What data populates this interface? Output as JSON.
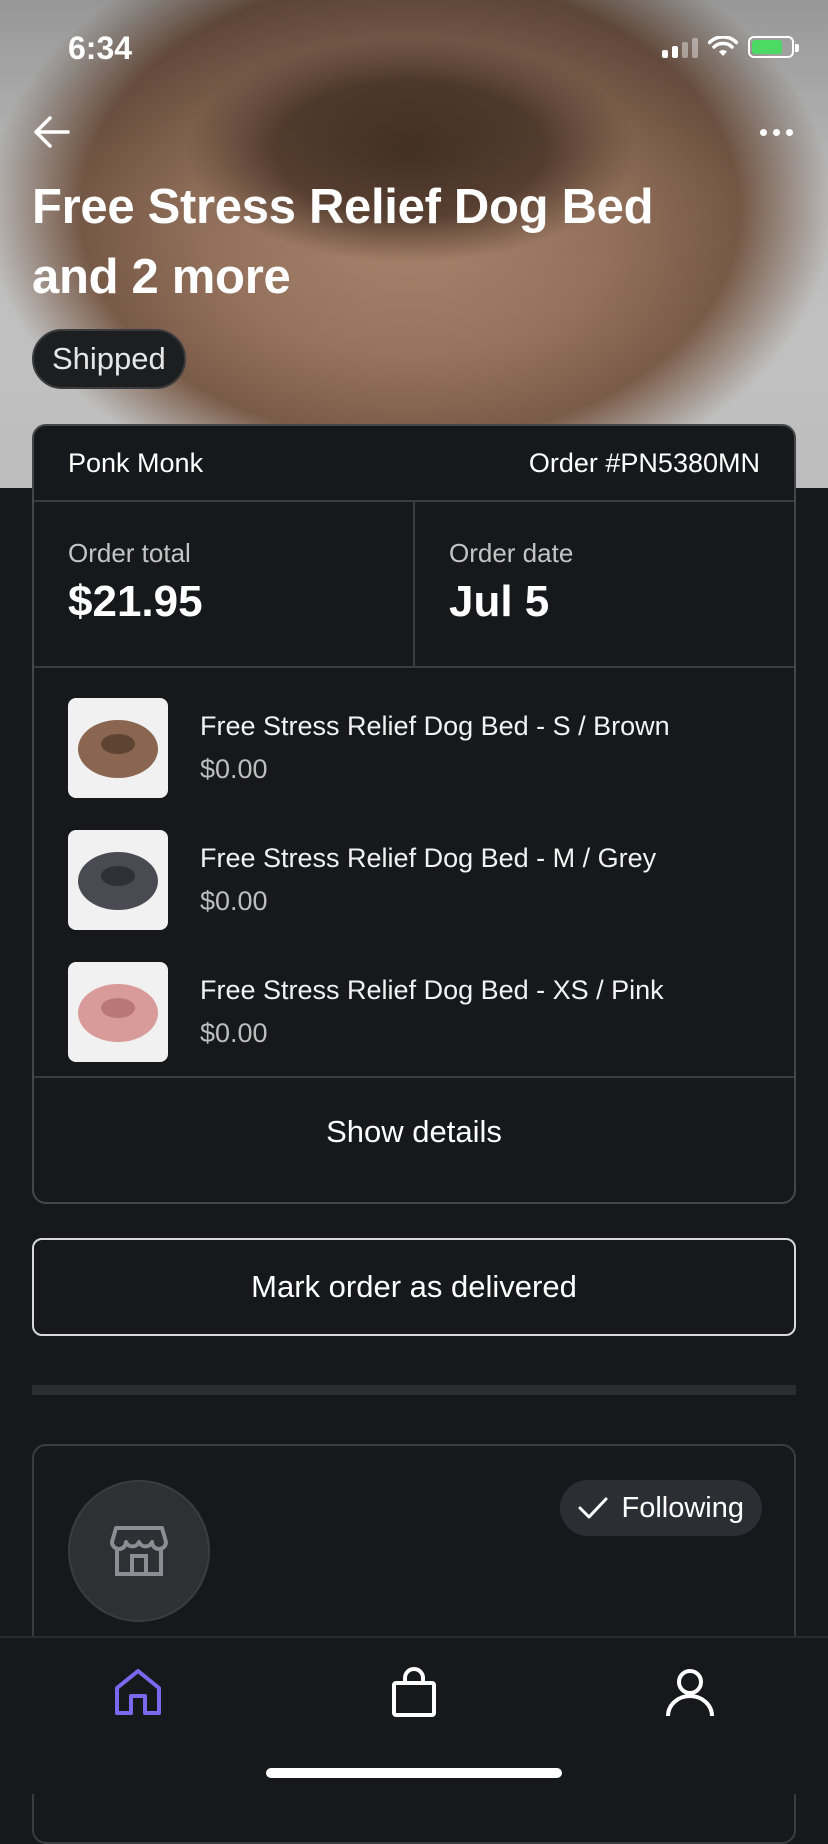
{
  "status_bar": {
    "time": "6:34"
  },
  "header": {
    "title": "Free Stress Relief Dog Bed and 2 more",
    "status_badge": "Shipped"
  },
  "order": {
    "store_name": "Ponk Monk",
    "order_number": "Order #PN5380MN",
    "total_label": "Order total",
    "total_value": "$21.95",
    "date_label": "Order date",
    "date_value": "Jul 5",
    "items": [
      {
        "name": "Free Stress Relief Dog Bed - S / Brown",
        "price": "$0.00",
        "color": "#8a6550"
      },
      {
        "name": "Free Stress Relief Dog Bed - M / Grey",
        "price": "$0.00",
        "color": "#4a4b52"
      },
      {
        "name": "Free Stress Relief Dog Bed - XS / Pink",
        "price": "$0.00",
        "color": "#d99a9a"
      }
    ],
    "show_details_label": "Show details"
  },
  "actions": {
    "mark_delivered_label": "Mark order as delivered"
  },
  "shop": {
    "follow_label": "Following"
  },
  "tabbar": {
    "active_color": "#7b68ee",
    "items": [
      "home-icon",
      "bag-icon",
      "profile-icon"
    ]
  }
}
